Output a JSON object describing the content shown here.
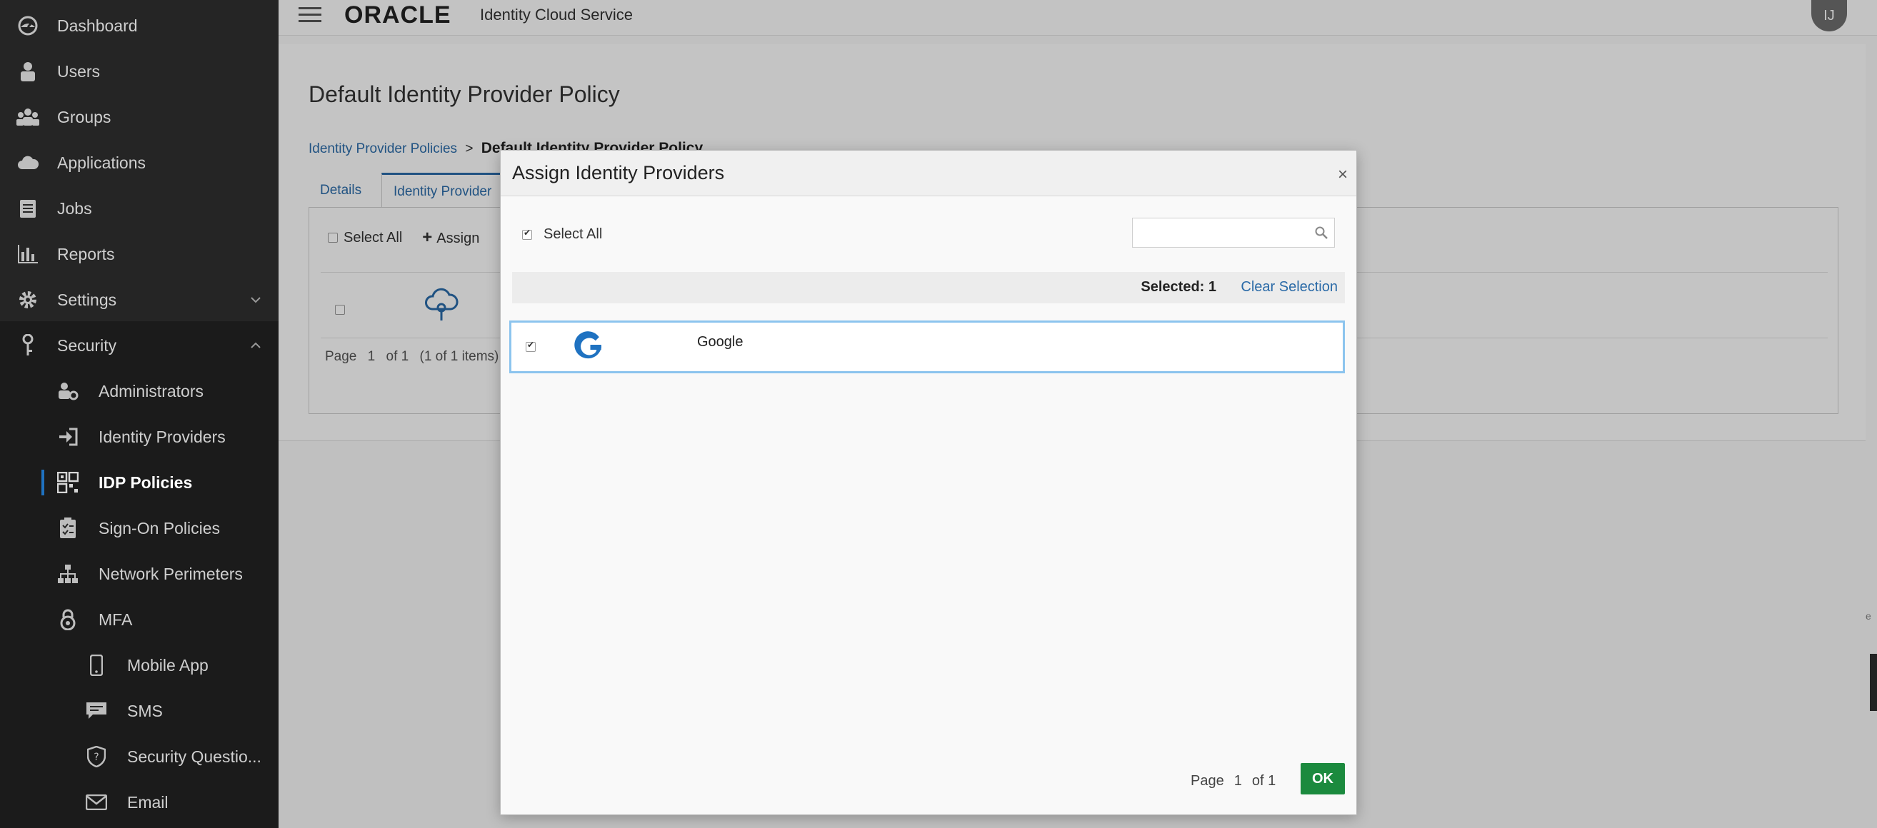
{
  "sidebar": {
    "items": [
      {
        "label": "Dashboard",
        "icon": "dashboard-icon"
      },
      {
        "label": "Users",
        "icon": "user-icon"
      },
      {
        "label": "Groups",
        "icon": "groups-icon"
      },
      {
        "label": "Applications",
        "icon": "cloud-icon"
      },
      {
        "label": "Jobs",
        "icon": "jobs-icon"
      },
      {
        "label": "Reports",
        "icon": "bar-chart-icon"
      },
      {
        "label": "Settings",
        "icon": "gear-icon"
      },
      {
        "label": "Security",
        "icon": "key-icon"
      },
      {
        "label": "Administrators",
        "icon": "admin-icon"
      },
      {
        "label": "Identity Providers",
        "icon": "sign-in-icon"
      },
      {
        "label": "IDP Policies",
        "icon": "qr-policy-icon"
      },
      {
        "label": "Sign-On Policies",
        "icon": "checklist-icon"
      },
      {
        "label": "Network Perimeters",
        "icon": "network-icon"
      },
      {
        "label": "MFA",
        "icon": "lock-icon"
      },
      {
        "label": "Mobile App",
        "icon": "mobile-icon"
      },
      {
        "label": "SMS",
        "icon": "chat-icon"
      },
      {
        "label": "Security Questio...",
        "icon": "shield-question-icon"
      },
      {
        "label": "Email",
        "icon": "envelope-icon"
      }
    ]
  },
  "header": {
    "logo": "ORACLE",
    "product": "Identity Cloud Service",
    "avatar": "IJ"
  },
  "page": {
    "title": "Default Identity Provider Policy",
    "breadcrumb_link": "Identity Provider Policies",
    "breadcrumb_sep": ">",
    "breadcrumb_current": "Default Identity Provider Policy",
    "tabs": [
      "Details",
      "Identity Provider"
    ],
    "select_all": "Select All",
    "assign": "Assign",
    "pager": {
      "page_label": "Page",
      "page": "1",
      "of": "of 1",
      "items": "(1 of 1 items)"
    }
  },
  "modal": {
    "title": "Assign Identity Providers",
    "close": "×",
    "select_all": "Select All",
    "search_placeholder": "",
    "selected": "Selected: 1",
    "clear_selection": "Clear Selection",
    "rows": [
      {
        "name": "Google",
        "checked": true
      }
    ],
    "pager": {
      "page_label": "Page",
      "page": "1",
      "of": "of 1"
    },
    "ok": "OK"
  },
  "colors": {
    "sidebar_bg": "#252525",
    "link": "#2a6aa7",
    "ok_button": "#1b8a3e",
    "selection_border": "#8cc4ee"
  }
}
